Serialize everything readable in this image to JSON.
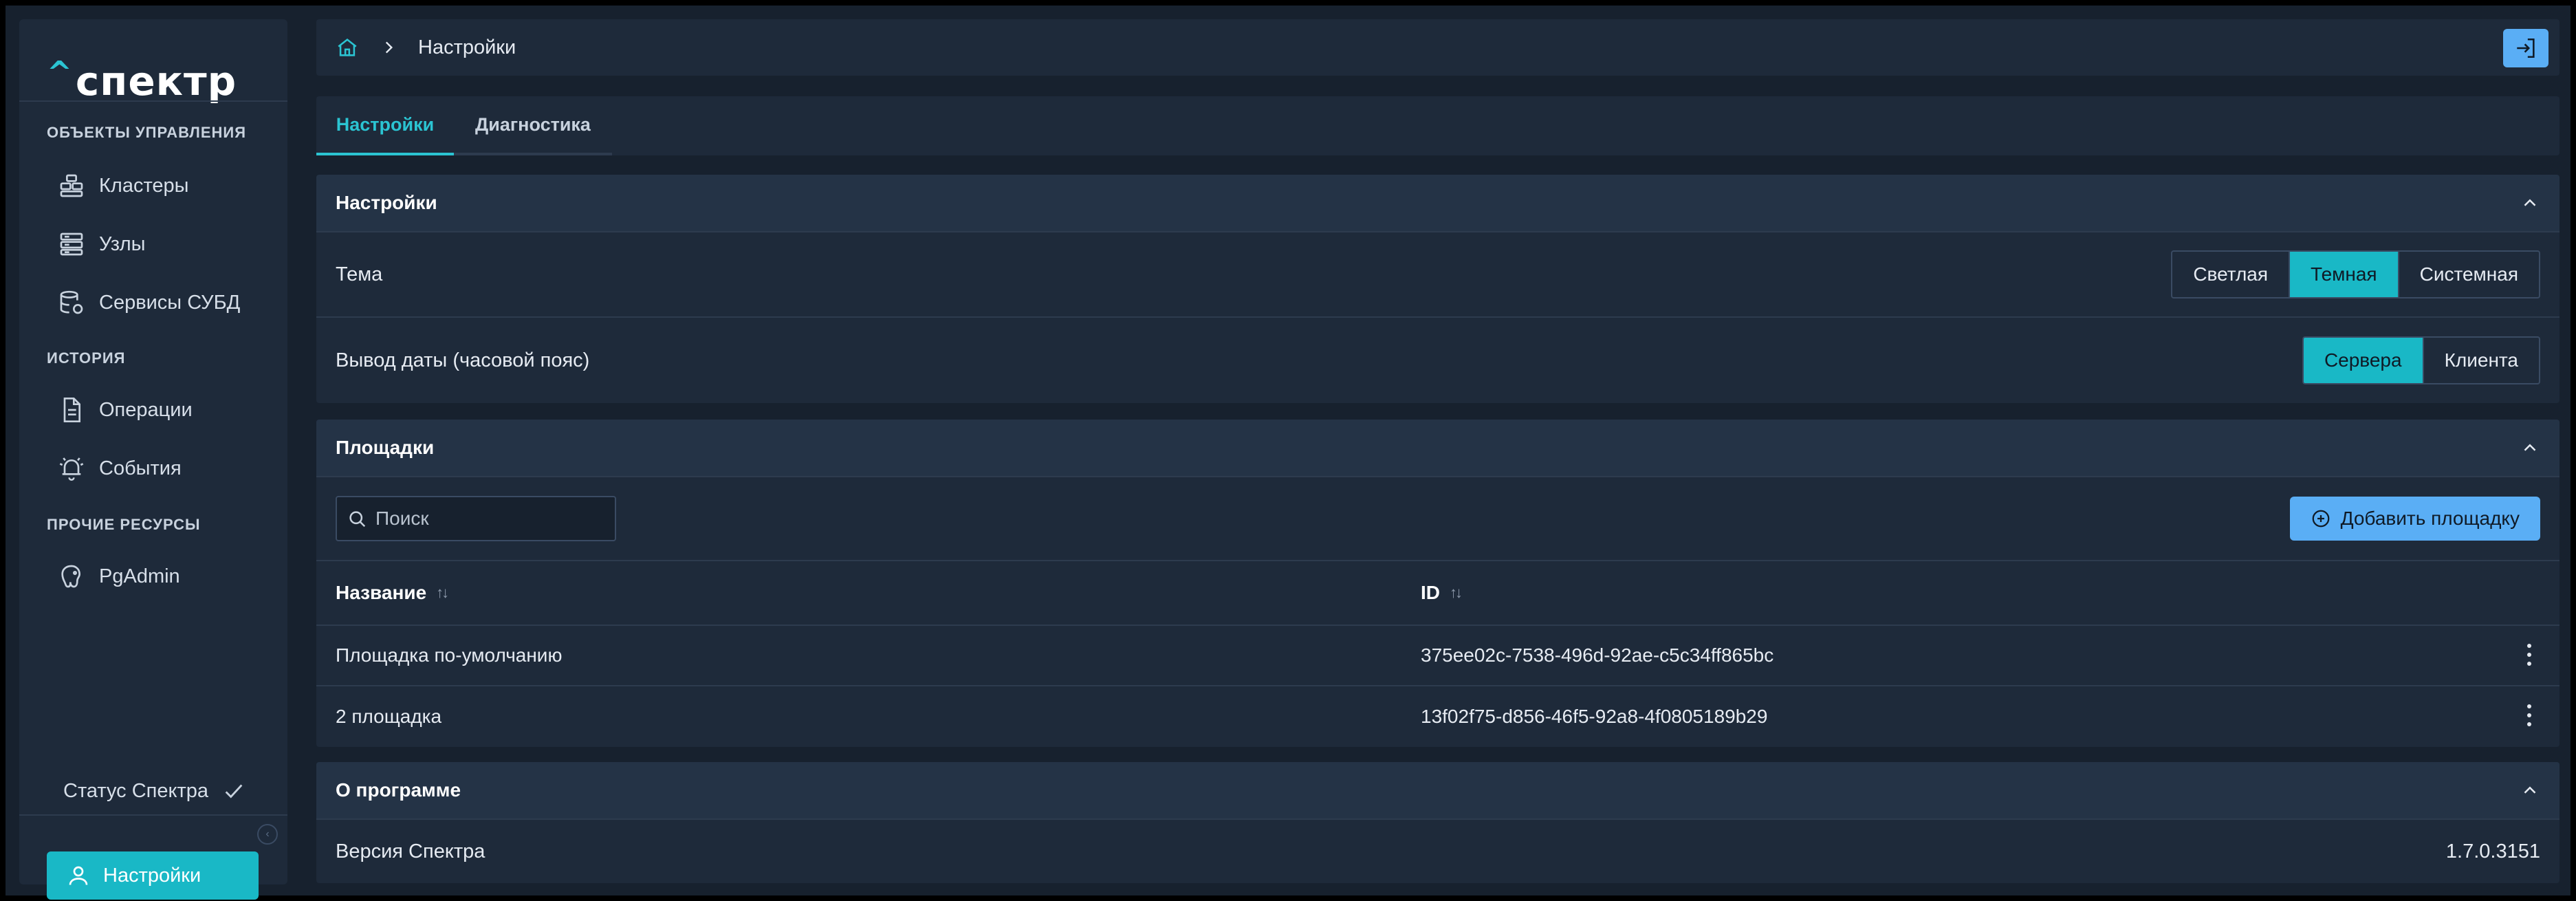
{
  "app": {
    "logo_caret": "^",
    "logo_text": "спектр"
  },
  "sidebar": {
    "sections": [
      {
        "label": "ОБЪЕКТЫ УПРАВЛЕНИЯ"
      },
      {
        "label": "ИСТОРИЯ"
      },
      {
        "label": "ПРОЧИЕ РЕСУРСЫ"
      }
    ],
    "items": [
      {
        "label": "Кластеры",
        "icon": "clusters-icon"
      },
      {
        "label": "Узлы",
        "icon": "nodes-icon"
      },
      {
        "label": "Сервисы СУБД",
        "icon": "dbms-services-icon"
      },
      {
        "label": "Операции",
        "icon": "operations-icon"
      },
      {
        "label": "События",
        "icon": "events-icon"
      },
      {
        "label": "PgAdmin",
        "icon": "pgadmin-icon"
      }
    ],
    "status_label": "Статус Спектра",
    "settings_label": "Настройки"
  },
  "topbar": {
    "breadcrumb_current": "Настройки"
  },
  "tabs": [
    {
      "label": "Настройки",
      "active": true
    },
    {
      "label": "Диагностика",
      "active": false
    }
  ],
  "settings_panel": {
    "title": "Настройки",
    "theme": {
      "label": "Тема",
      "options": [
        "Светлая",
        "Темная",
        "Системная"
      ],
      "selected": "Темная"
    },
    "date_output": {
      "label": "Вывод даты (часовой пояс)",
      "options": [
        "Сервера",
        "Клиента"
      ],
      "selected": "Сервера"
    }
  },
  "sites_panel": {
    "title": "Площадки",
    "search_placeholder": "Поиск",
    "add_button": "Добавить площадку",
    "columns": [
      "Название",
      "ID"
    ],
    "rows": [
      {
        "name": "Площадка по-умолчанию",
        "id": "375ee02c-7538-496d-92ae-c5c34ff865bc"
      },
      {
        "name": "2 площадка",
        "id": "13f02f75-d856-46f5-92a8-4f0805189b29"
      }
    ]
  },
  "about_panel": {
    "title": "О программе",
    "version_label": "Версия Спектра",
    "version_value": "1.7.0.3151"
  },
  "colors": {
    "accent": "#19b8c6",
    "primary_button": "#5aaef5",
    "surface": "#1e2a3a",
    "background": "#17212e"
  }
}
